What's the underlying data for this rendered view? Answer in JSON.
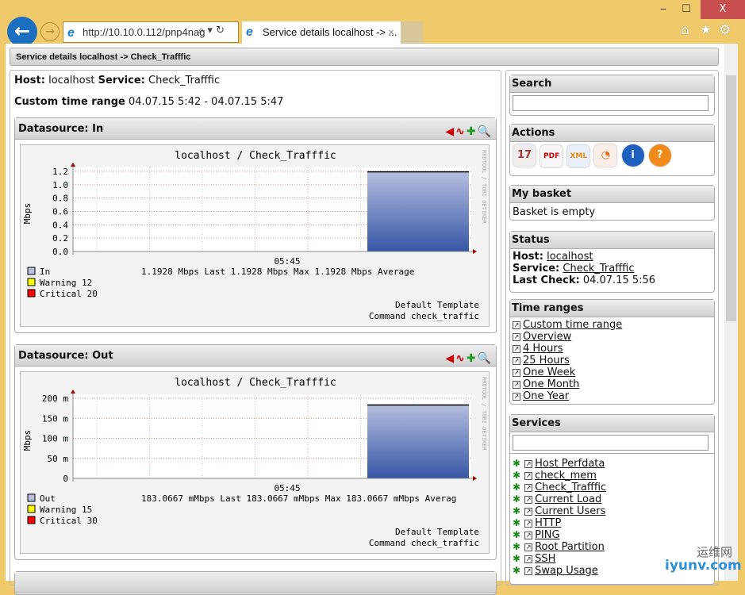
{
  "browser": {
    "url": "http://10.10.0.112/pnp4nag",
    "tab_title": "Service details localhost -> ...",
    "window_controls": {
      "minimize": "‒",
      "maximize": "☐",
      "close": "X"
    }
  },
  "breadcrumb": "Service details localhost -> Check_Trafffic",
  "main": {
    "host_label": "Host:",
    "host": "localhost",
    "service_label": "Service:",
    "service": "Check_Trafffic",
    "range_label": "Custom time range",
    "range": "04.07.15 5:42 - 04.07.15 5:47",
    "datasources": [
      {
        "title": "Datasource: In",
        "graph": {
          "title": "localhost / Check_Trafffic",
          "ylabel": "Mbps",
          "ylim": [
            0,
            1.2
          ],
          "yticks": [
            "0.0",
            "0.2",
            "0.4",
            "0.6",
            "0.8",
            "1.0",
            "1.2"
          ],
          "xtick": "05:45",
          "value": 1.1928,
          "watermark": "RRDTOOL / TOBI OETIKER",
          "legend": {
            "series": "In",
            "stats": "1.1928  Mbps Last  1.1928  Mbps Max  1.1928  Mbps Average",
            "warning": "Warning  12",
            "critical": "Critical 20"
          },
          "template": "Default Template",
          "command": "Command check_traffic"
        }
      },
      {
        "title": "Datasource: Out",
        "graph": {
          "title": "localhost / Check_Trafffic",
          "ylabel": "Mbps",
          "ylim": [
            0,
            200
          ],
          "yticks": [
            "0",
            "50 m",
            "100 m",
            "150 m",
            "200 m"
          ],
          "xtick": "05:45",
          "value": 183.0667,
          "watermark": "RRDTOOL / TOBI OETIKER",
          "legend": {
            "series": "Out",
            "stats": "183.0667 mMbps Last  183.0667 mMbps Max  183.0667 mMbps Averag",
            "warning": "Warning  15",
            "critical": "Critical 30"
          },
          "template": "Default Template",
          "command": "Command check_traffic"
        }
      }
    ]
  },
  "sidebar": {
    "search": {
      "title": "Search",
      "value": ""
    },
    "actions": {
      "title": "Actions",
      "icons": [
        "calendar-icon",
        "pdf-icon",
        "xml-icon",
        "chart-icon",
        "info-icon",
        "help-icon"
      ]
    },
    "basket": {
      "title": "My basket",
      "text": "Basket is empty"
    },
    "status": {
      "title": "Status",
      "host_label": "Host:",
      "host": "localhost",
      "service_label": "Service:",
      "service": "Check_Trafffic",
      "last_label": "Last Check:",
      "last": "04.07.15 5:56"
    },
    "time_ranges": {
      "title": "Time ranges",
      "items": [
        "Custom time range",
        "Overview",
        "4 Hours",
        "25 Hours",
        "One Week",
        "One Month",
        "One Year"
      ]
    },
    "services": {
      "title": "Services",
      "filter": "",
      "items": [
        "Host Perfdata",
        "check_mem",
        "Check_Trafffic",
        "Current Load",
        "Current Users",
        "HTTP",
        "PING",
        "Root Partition",
        "SSH",
        "Swap Usage"
      ]
    }
  },
  "watermark": {
    "cn": "运维网",
    "en": "iyunv.com"
  },
  "colors": {
    "chrome": "#f0c96a",
    "area_top": "#b4bedf",
    "area_bottom": "#3656a6",
    "grid_major": "#f08080"
  }
}
